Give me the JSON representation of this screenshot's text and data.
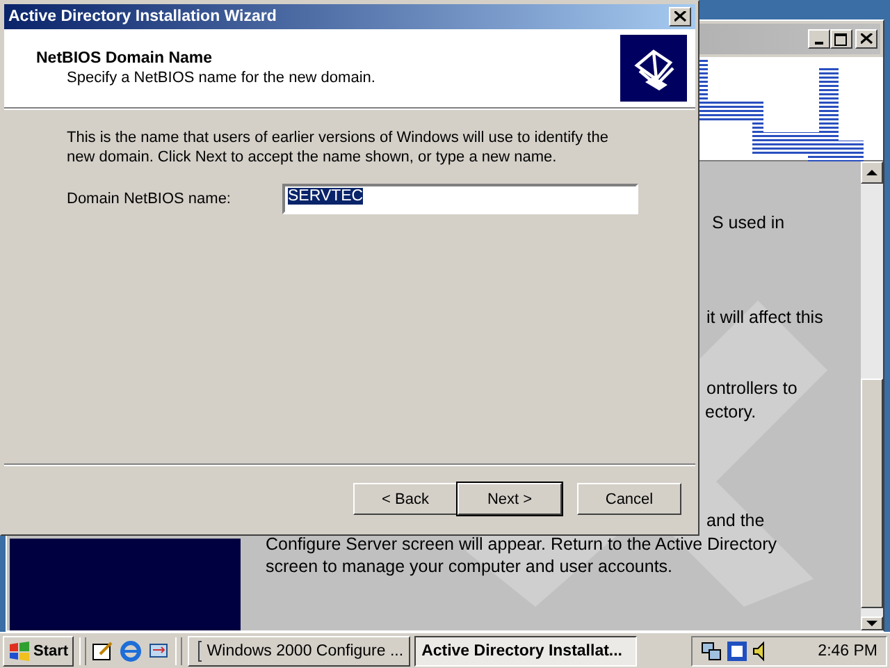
{
  "background_window": {
    "text_fragments": [
      {
        "text": "S used in"
      },
      {
        "text": "it will affect this"
      },
      {
        "text": "ontrollers to"
      },
      {
        "text": "ectory."
      },
      {
        "text": "and the"
      },
      {
        "text": "Configure Server screen will appear. Return to the Active Directory"
      },
      {
        "text": "screen to manage your computer and user accounts."
      }
    ]
  },
  "wizard": {
    "title": "Active Directory Installation Wizard",
    "header_title": "NetBIOS Domain Name",
    "header_subtitle": "Specify a NetBIOS name for the new domain.",
    "description": "This is the name that users of earlier versions of Windows will use to identify the new domain. Click Next to accept the name shown, or type a new name.",
    "field_label": "Domain NetBIOS name:",
    "field_value": "SERVTEC",
    "field_value_selected": true,
    "buttons": [
      {
        "label": "< Back",
        "default": false
      },
      {
        "label": "Next >",
        "default": true
      },
      {
        "label": "Cancel",
        "default": false
      }
    ]
  },
  "taskbar": {
    "start": "Start",
    "tasks": [
      {
        "label": "Windows 2000 Configure ...",
        "selected": false
      },
      {
        "label": "Active Directory Installat...",
        "selected": true
      }
    ],
    "clock": "2:46 PM"
  }
}
